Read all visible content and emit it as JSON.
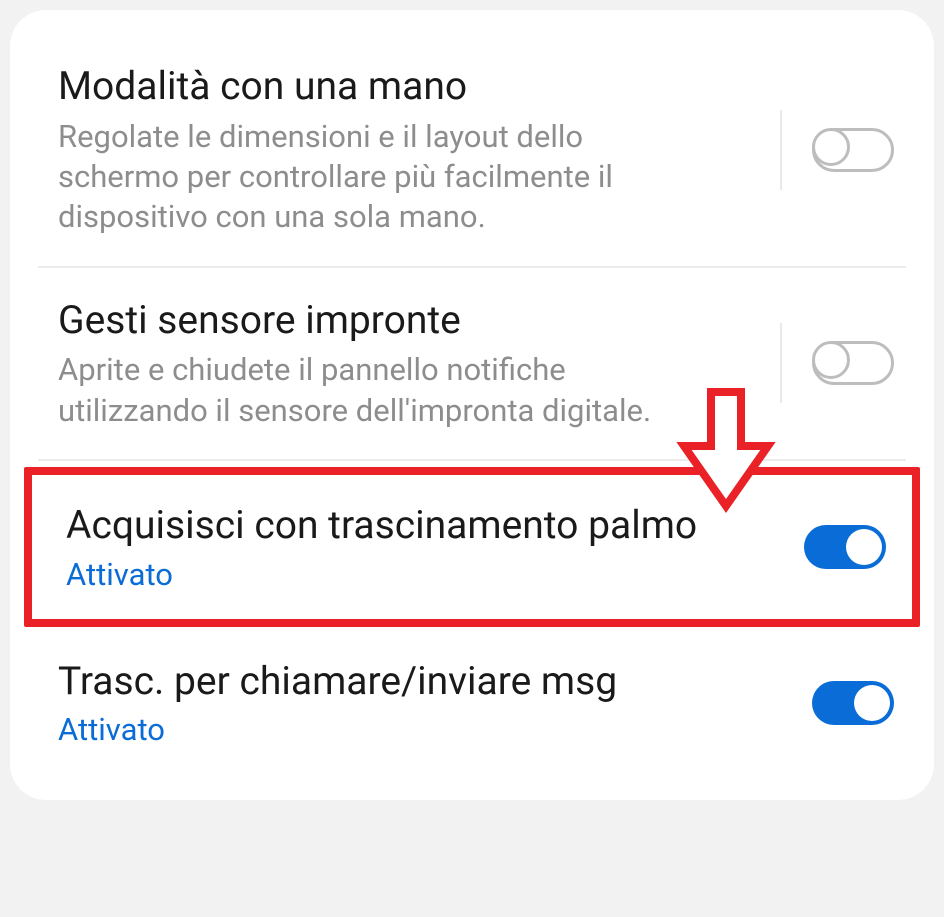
{
  "settings": [
    {
      "title": "Modalità con una mano",
      "desc": "Regolate le dimensioni e il layout dello schermo per controllare più facilmente il dispositivo con una sola mano.",
      "status": "",
      "on": false
    },
    {
      "title": "Gesti sensore impronte",
      "desc": "Aprite e chiudete il pannello notifiche utilizzando il sensore dell'impronta digitale.",
      "status": "",
      "on": false
    },
    {
      "title": "Acquisisci con trascinamento palmo",
      "desc": "",
      "status": "Attivato",
      "on": true
    },
    {
      "title": "Trasc. per chiamare/inviare msg",
      "desc": "",
      "status": "Attivato",
      "on": true
    }
  ]
}
